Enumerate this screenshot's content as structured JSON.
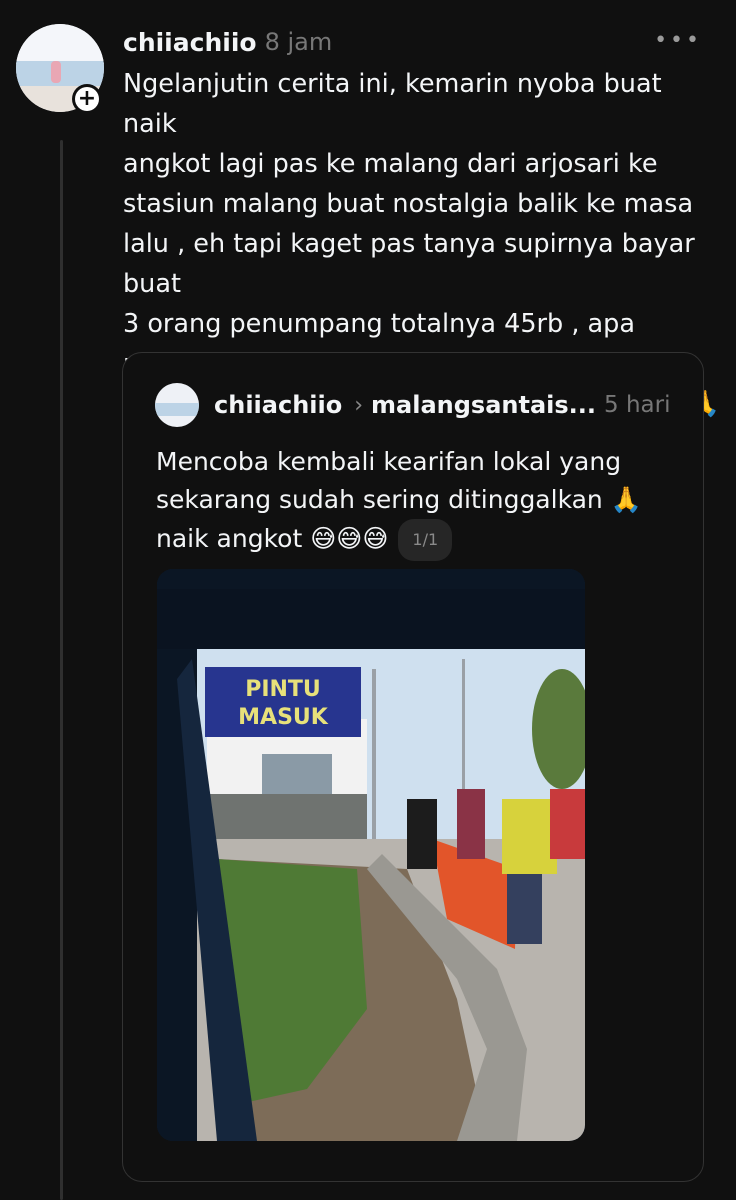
{
  "post": {
    "username": "chiiachiio",
    "time": "8 jam",
    "text": "Ngelanjutin cerita ini, kemarin nyoba buat naik\nangkot lagi pas ke malang dari arjosari ke\nstasiun malang buat nostalgia balik ke masa\nlalu , eh tapi kaget pas tanya supirnya bayar buat\n3 orang penumpang totalnya 45rb , apa memang\nsekarang harga angkot memang segitu yaa 🙏\n🙏",
    "more_icon": "more-horizontal-icon",
    "follow_icon": "plus-icon"
  },
  "quote": {
    "username": "chiiachiio",
    "target": "malangsantais...",
    "time": "5 hari",
    "text": "Mencoba kembali kearifan lokal yang\nsekarang sudah sering ditinggalkan 🙏\nnaik angkot 😅😅😅",
    "counter": "1/1"
  },
  "photo": {
    "sign_line1": "PINTU",
    "sign_line2": "MASUK"
  }
}
